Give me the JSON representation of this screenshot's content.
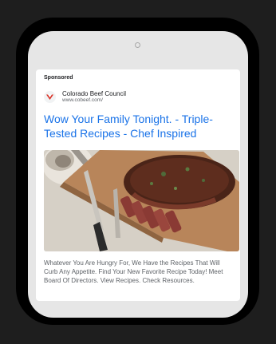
{
  "ad": {
    "sponsored_label": "Sponsored",
    "advertiser": {
      "name": "Colorado Beef Council",
      "url": "www.cobeef.com/",
      "logo_icon": "checkmark-logo-icon"
    },
    "headline": "Wow Your Family Tonight. - Triple-Tested Recipes - Chef Inspired",
    "image_subject": "sliced-steak-on-cutting-board",
    "description": "Whatever You Are Hungry For, We Have the Recipes That Will Curb Any Appetite. Find Your New Favorite Recipe Today! Meet Board Of Directors. View Recipes. Check Resources."
  },
  "colors": {
    "headline": "#1a73e8",
    "logo_red": "#d93025",
    "page_background": "#1e1e1e",
    "device_frame": "#000000",
    "screen": "#e6e6e6"
  }
}
